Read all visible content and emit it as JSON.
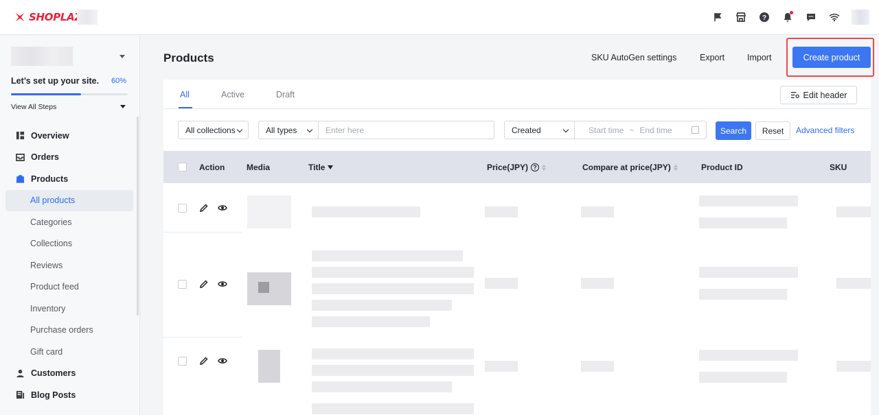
{
  "topbar": {
    "brand": "SHOPLAZZA",
    "icons": [
      "flag-icon",
      "store-icon",
      "help-icon",
      "bell-icon",
      "message-icon",
      "wifi-icon"
    ]
  },
  "sidebar": {
    "setup": {
      "title": "Let’s set up your site.",
      "percent_label": "60%",
      "progress": 0.6,
      "steps_label": "View All Steps"
    },
    "items": [
      {
        "label": "Overview",
        "icon": "overview-icon"
      },
      {
        "label": "Orders",
        "icon": "orders-icon"
      },
      {
        "label": "Products",
        "icon": "products-icon"
      }
    ],
    "product_subitems": [
      "All products",
      "Categories",
      "Collections",
      "Reviews",
      "Product feed",
      "Inventory",
      "Purchase orders",
      "Gift card"
    ],
    "items_after": [
      {
        "label": "Customers",
        "icon": "customers-icon"
      },
      {
        "label": "Blog Posts",
        "icon": "blog-icon"
      }
    ]
  },
  "header": {
    "title": "Products",
    "sku_settings": "SKU AutoGen settings",
    "export": "Export",
    "import": "Import",
    "create": "Create product"
  },
  "tabs": [
    "All",
    "Active",
    "Draft"
  ],
  "edit_header": "Edit header",
  "filters": {
    "collection": "All collections",
    "type": "All types",
    "search_placeholder": "Enter here",
    "date_field": "Created",
    "start_placeholder": "Start time",
    "date_sep": "~",
    "end_placeholder": "End time",
    "search_button": "Search",
    "reset_button": "Reset",
    "advanced": "Advanced filters"
  },
  "table": {
    "columns": [
      "Action",
      "Media",
      "Title",
      "Price(JPY)",
      "Compare at price(JPY)",
      "Product ID",
      "SKU"
    ],
    "help_glyph": "?"
  },
  "colors": {
    "accent": "#3c76f2",
    "brand": "#e8233a",
    "highlight": "#e84a4a"
  }
}
